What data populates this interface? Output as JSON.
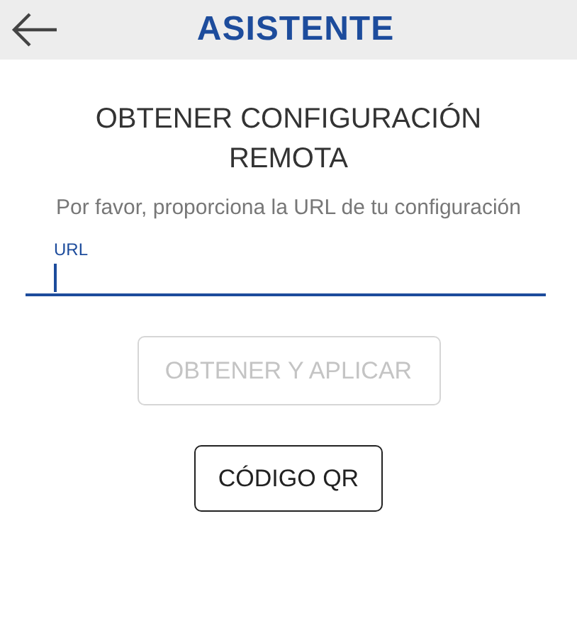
{
  "header": {
    "title": "ASISTENTE"
  },
  "heading": "OBTENER CONFIGURACIÓN REMOTA",
  "instructions": "Por favor, proporciona la URL de tu configuración",
  "url_field": {
    "label": "URL",
    "focused": true
  },
  "buttons": [
    {
      "label": "OBTENER Y APLICAR",
      "disabled": true
    },
    {
      "label": "CÓDIGO QR",
      "disabled": false
    }
  ]
}
